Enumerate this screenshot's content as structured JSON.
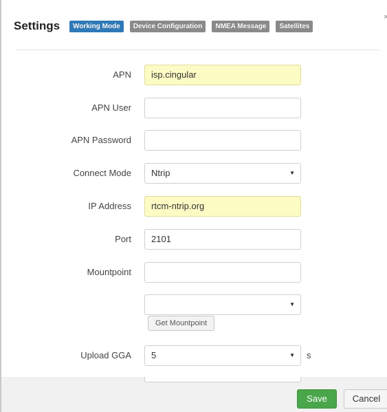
{
  "header": {
    "title": "Settings",
    "tabs": [
      {
        "label": "Working Mode",
        "active": true
      },
      {
        "label": "Device Configuration",
        "active": false
      },
      {
        "label": "NMEA Message",
        "active": false
      },
      {
        "label": "Satellites",
        "active": false
      }
    ]
  },
  "form": {
    "apn": {
      "label": "APN",
      "value": "isp.cingular"
    },
    "apn_user": {
      "label": "APN User",
      "value": ""
    },
    "apn_password": {
      "label": "APN Password",
      "value": ""
    },
    "connect_mode": {
      "label": "Connect Mode",
      "value": "Ntrip"
    },
    "ip_address": {
      "label": "IP Address",
      "value": "rtcm-ntrip.org"
    },
    "port": {
      "label": "Port",
      "value": "2101"
    },
    "mountpoint": {
      "label": "Mountpoint",
      "value": ""
    },
    "mountpoint_select": {
      "value": ""
    },
    "get_mountpoint_label": "Get Mountpoint",
    "upload_gga": {
      "label": "Upload GGA",
      "value": "5",
      "unit": "s"
    }
  },
  "footer": {
    "save_label": "Save",
    "cancel_label": "Cancel"
  },
  "colors": {
    "active_tab": "#2f79b8",
    "inactive_tab": "#8a8a8a",
    "highlight_field": "#fcfbc4",
    "save_button": "#4aa64a"
  },
  "icons": {
    "select_caret": "caret-down-icon"
  }
}
